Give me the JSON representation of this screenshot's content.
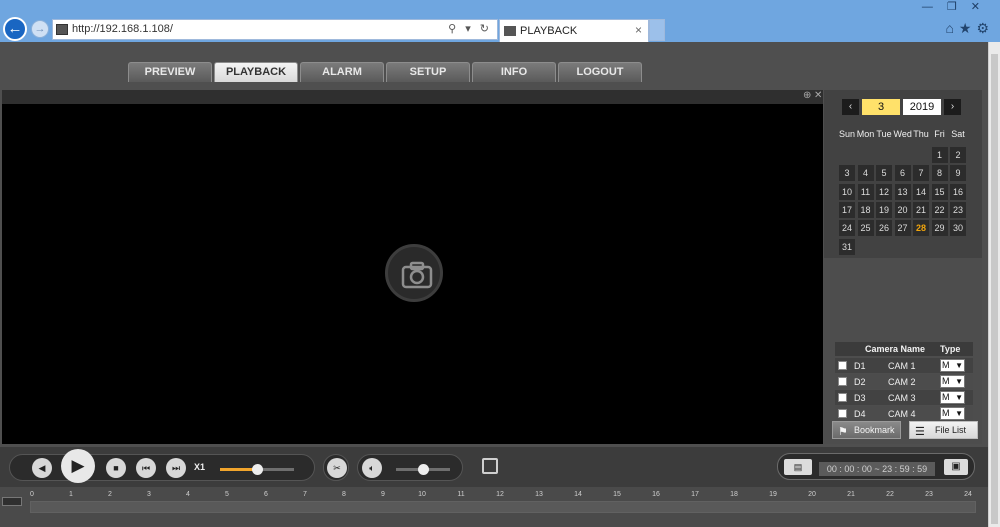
{
  "browser": {
    "url": "http://192.168.1.108/",
    "address_tools": "⚲ ▾ ↻",
    "tab_title": "PLAYBACK",
    "tab_close": "×",
    "window_controls": "—❐✕",
    "right_icons": "⌂★⚙"
  },
  "nav": {
    "tabs": [
      {
        "label": "PREVIEW",
        "active": false
      },
      {
        "label": "PLAYBACK",
        "active": true
      },
      {
        "label": "ALARM",
        "active": false
      },
      {
        "label": "SETUP",
        "active": false
      },
      {
        "label": "INFO",
        "active": false
      },
      {
        "label": "LOGOUT",
        "active": false
      }
    ]
  },
  "video": {
    "zoom_icon": "zoom-icon",
    "close_icon": "close-icon",
    "placeholder_icon": "camera-icon"
  },
  "calendar": {
    "prev": "‹",
    "next": "›",
    "month": "3",
    "year": "2019",
    "weekdays": [
      "Sun",
      "Mon",
      "Tue",
      "Wed",
      "Thu",
      "Fri",
      "Sat"
    ],
    "first_weekday_index": 5,
    "days_in_month": 31,
    "highlight_day": 28,
    "highlight_color": "#f2a60c"
  },
  "channels": {
    "header_name": "Camera Name",
    "header_type": "Type",
    "rows": [
      {
        "id": "D1",
        "name": "CAM 1",
        "type": "M"
      },
      {
        "id": "D2",
        "name": "CAM 2",
        "type": "M"
      },
      {
        "id": "D3",
        "name": "CAM 3",
        "type": "M"
      },
      {
        "id": "D4",
        "name": "CAM 4",
        "type": "M"
      }
    ]
  },
  "buttons": {
    "bookmark": "Bookmark",
    "file_list": "File List"
  },
  "controls": {
    "speed": "X1",
    "play_progress": 0.5,
    "volume": 0.5,
    "time_range": "00 : 00 : 00 ~ 23 : 59 : 59",
    "accent_color": "#f1a52c"
  },
  "timeline": {
    "ticks": [
      "0",
      "1",
      "2",
      "3",
      "4",
      "5",
      "6",
      "7",
      "8",
      "9",
      "10",
      "11",
      "12",
      "13",
      "14",
      "15",
      "16",
      "17",
      "18",
      "19",
      "20",
      "21",
      "22",
      "23",
      "24"
    ]
  }
}
